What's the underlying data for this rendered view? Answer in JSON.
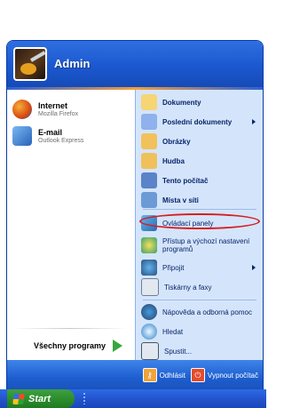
{
  "user": {
    "name": "Admin"
  },
  "left_pinned": [
    {
      "title": "Internet",
      "subtitle": "Mozilla Firefox",
      "icon": "firefox-icon"
    },
    {
      "title": "E-mail",
      "subtitle": "Outlook Express",
      "icon": "outlook-express-icon"
    }
  ],
  "all_programs_label": "Všechny programy",
  "right_items": [
    {
      "label": "Dokumenty",
      "icon": "documents-folder-icon",
      "bold": true,
      "submenu": false
    },
    {
      "label": "Poslední dokumenty",
      "icon": "recent-documents-icon",
      "bold": true,
      "submenu": true
    },
    {
      "label": "Obrázky",
      "icon": "pictures-folder-icon",
      "bold": true,
      "submenu": false
    },
    {
      "label": "Hudba",
      "icon": "music-folder-icon",
      "bold": true,
      "submenu": false
    },
    {
      "label": "Tento počítač",
      "icon": "my-computer-icon",
      "bold": true,
      "submenu": false
    },
    {
      "label": "Místa v síti",
      "icon": "network-places-icon",
      "bold": true,
      "submenu": false
    },
    {
      "label": "Ovládací panely",
      "icon": "control-panel-icon",
      "bold": false,
      "submenu": false
    },
    {
      "label": "Přístup a výchozí nastavení programů",
      "icon": "program-access-icon",
      "bold": false,
      "submenu": false
    },
    {
      "label": "Připojit",
      "icon": "connect-icon",
      "bold": false,
      "submenu": true
    },
    {
      "label": "Tiskárny a faxy",
      "icon": "printers-icon",
      "bold": false,
      "submenu": false
    },
    {
      "label": "Nápověda a odborná pomoc",
      "icon": "help-icon",
      "bold": false,
      "submenu": false
    },
    {
      "label": "Hledat",
      "icon": "search-icon",
      "bold": false,
      "submenu": false
    },
    {
      "label": "Spustit...",
      "icon": "run-icon",
      "bold": false,
      "submenu": false
    }
  ],
  "footer": {
    "logoff_label": "Odhlásit",
    "shutdown_label": "Vypnout počítač"
  },
  "taskbar": {
    "start_label": "Start"
  },
  "colors": {
    "highlight_ring": "#d61e22",
    "taskbar_blue": "#2253cc",
    "start_green": "#2a8a2b"
  }
}
